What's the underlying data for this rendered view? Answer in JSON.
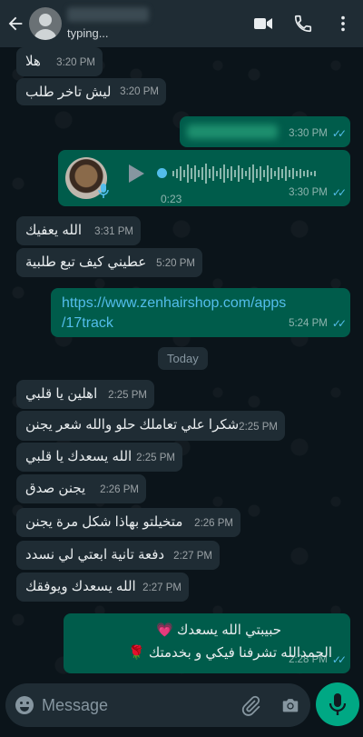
{
  "header": {
    "status": "typing...",
    "icons": [
      "back-arrow-icon",
      "avatar",
      "video-call-icon",
      "phone-icon",
      "more-vert-icon"
    ]
  },
  "messages": [
    {
      "dir": "in",
      "text": "هلا",
      "time": "3:20 PM"
    },
    {
      "dir": "in",
      "text": "ليش تاخر طلب",
      "time": "3:20 PM"
    },
    {
      "dir": "out",
      "text": "",
      "time": "3:30 PM",
      "status": "read"
    },
    {
      "dir": "out",
      "type": "voice",
      "duration": "0:23",
      "time": "3:30 PM",
      "status": "read"
    },
    {
      "dir": "in",
      "text": "الله يعفيك",
      "time": "3:31 PM"
    },
    {
      "dir": "in",
      "text": "عطيني كيف تبع طلبية",
      "time": "5:20 PM"
    },
    {
      "dir": "out",
      "type": "link",
      "text_line1": "https://www.zenhairshop.com/apps",
      "text_line2": "/17track",
      "time": "5:24 PM",
      "status": "read"
    },
    {
      "dir": "in",
      "text": "اهلين يا قلبي",
      "time": "2:25 PM"
    },
    {
      "dir": "in",
      "text": "شكرا علي تعاملك حلو والله شعر يجنن",
      "time": "2:25 PM"
    },
    {
      "dir": "in",
      "text": "الله يسعدك يا قلبي",
      "time": "2:25 PM"
    },
    {
      "dir": "in",
      "text": "يجنن صدق",
      "time": "2:26 PM"
    },
    {
      "dir": "in",
      "text": "متخيلتو بهاذا شكل مرة يجنن",
      "time": "2:26 PM"
    },
    {
      "dir": "in",
      "text": "دفعة تانية ابعتي لي نسدد",
      "time": "2:27 PM"
    },
    {
      "dir": "in",
      "text": "الله يسعدك ويوفقك",
      "time": "2:27 PM"
    },
    {
      "dir": "out",
      "line1": "حبيبتي  الله يسعدك 💗",
      "line2": "الحمدالله تشرفنا فيكي و بخدمتك 🌹",
      "time": "2:28 PM",
      "status": "read"
    }
  ],
  "date_chip": "Today",
  "input": {
    "placeholder": "Message"
  },
  "colors": {
    "accent": "#00a884",
    "outgoing": "#005c4b",
    "incoming": "#1f2c34",
    "read_ticks": "#53bdeb",
    "background": "#0b141a"
  }
}
